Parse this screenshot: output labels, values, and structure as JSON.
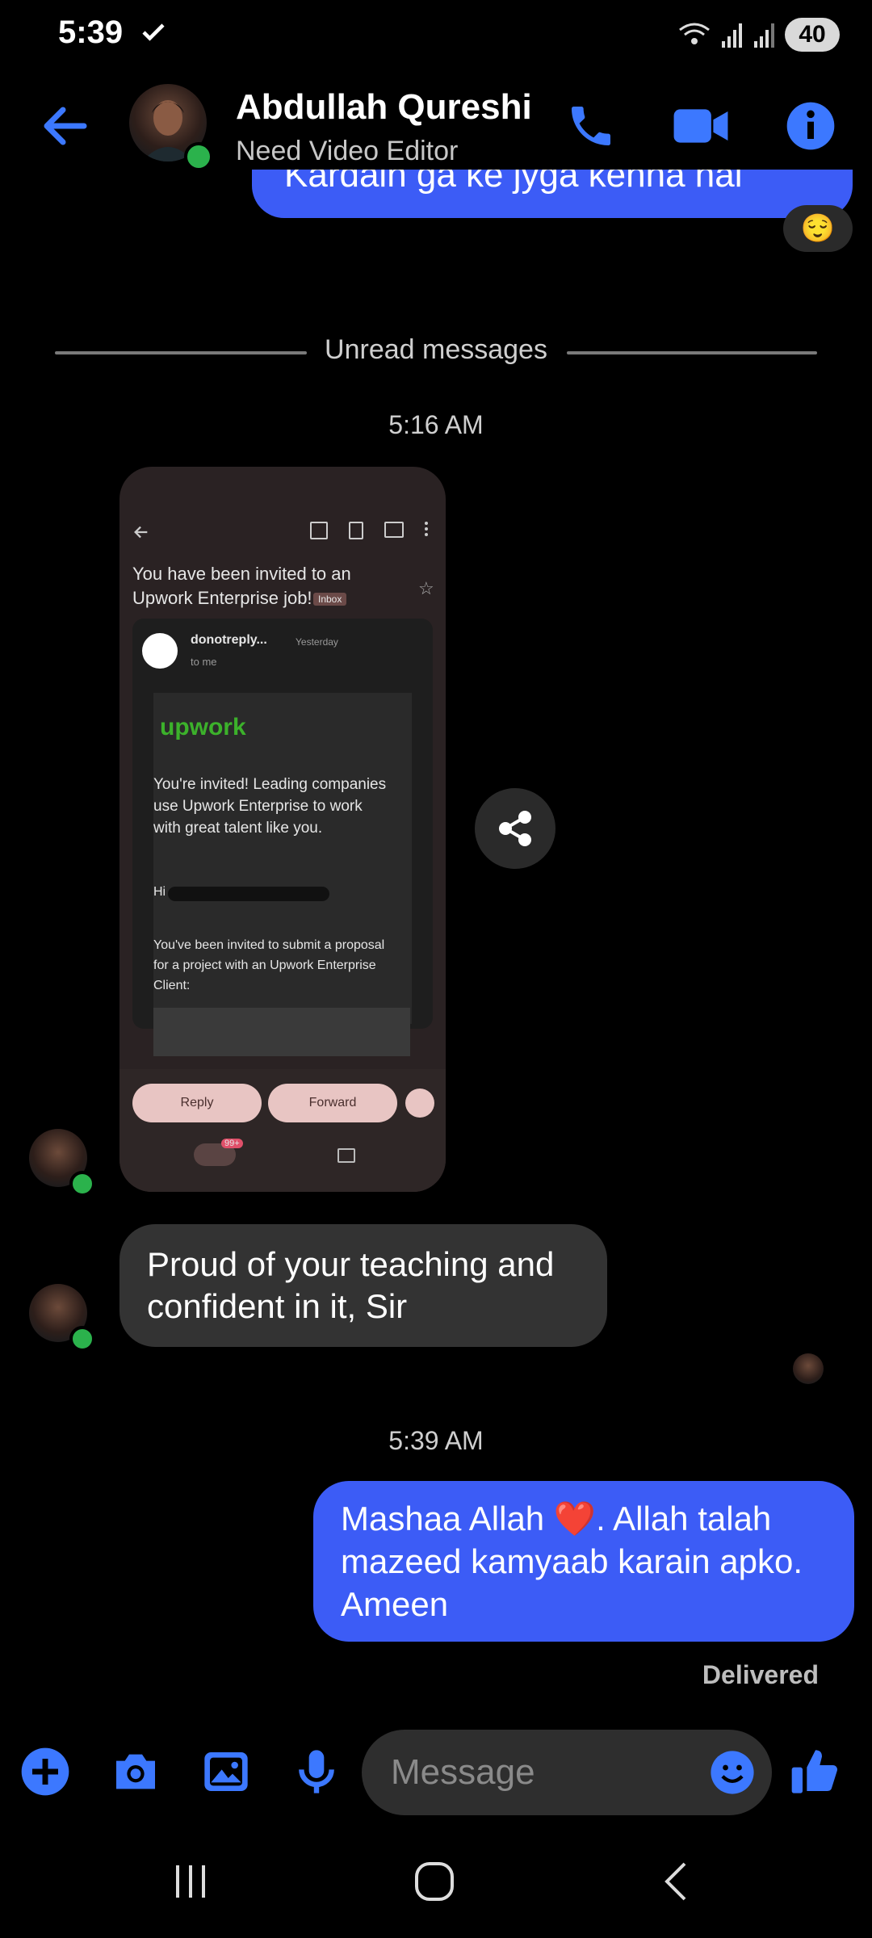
{
  "status_bar": {
    "time": "5:39",
    "battery": "40"
  },
  "header": {
    "name": "Abdullah Qureshi",
    "subtitle": "Need Video Editor"
  },
  "chat": {
    "partial_message_text": "Kardain ga ke jyga kehna hai",
    "reaction_emoji": "😌",
    "unread_label": "Unread messages",
    "timestamp_1": "5:16 AM",
    "timestamp_2": "5:39 AM",
    "incoming_text": "Proud of your teaching and confident in it, Sir",
    "outgoing_text": "Mashaa Allah ❤️. Allah talah mazeed kamyaab karain apko. Ameen",
    "delivery_status": "Delivered"
  },
  "shared_screenshot": {
    "subject": "You have been invited to an Upwork Enterprise job!",
    "label": "Inbox",
    "sender": "donotreply...",
    "sent_time": "Yesterday",
    "recipient": "to me",
    "brand": "upwork",
    "intro": "You're invited! Leading companies use Upwork Enterprise to work with great talent like you.",
    "greeting": "Hi",
    "body": "You've been invited to submit a proposal for a project with an Upwork Enterprise Client:",
    "reply_label": "Reply",
    "forward_label": "Forward",
    "badge": "99+"
  },
  "composer": {
    "placeholder": "Message"
  },
  "colors": {
    "accent": "#3c5cf6",
    "incoming_bubble": "#333333",
    "online": "#2bb24c"
  }
}
